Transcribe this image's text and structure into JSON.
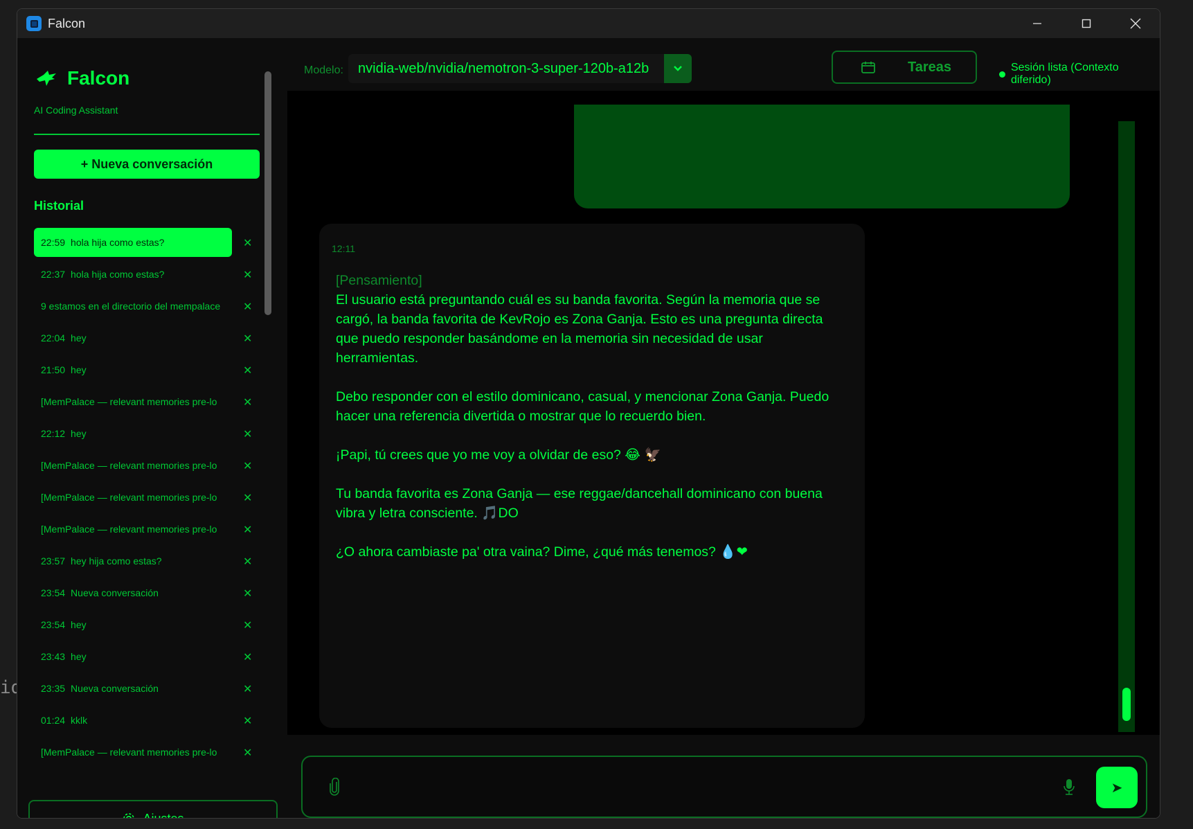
{
  "window": {
    "title": "Falcon"
  },
  "background_text": "id",
  "sidebar": {
    "brand_name": "Falcon",
    "brand_sub": "AI Coding Assistant",
    "new_conversation": "+  Nueva conversación",
    "history_title": "Historial",
    "history": [
      {
        "time": "22:59",
        "label": "hola hija como estas?",
        "active": true
      },
      {
        "time": "22:37",
        "label": "hola hija como estas?"
      },
      {
        "time": "",
        "label": "9  estamos en el directorio del mempalace"
      },
      {
        "time": "22:04",
        "label": "hey"
      },
      {
        "time": "21:50",
        "label": "hey"
      },
      {
        "time": "",
        "label": "[MemPalace — relevant memories pre-lo"
      },
      {
        "time": "22:12",
        "label": "hey"
      },
      {
        "time": "",
        "label": "[MemPalace — relevant memories pre-lo"
      },
      {
        "time": "",
        "label": "[MemPalace — relevant memories pre-lo"
      },
      {
        "time": "",
        "label": "[MemPalace — relevant memories pre-lo"
      },
      {
        "time": "23:57",
        "label": "hey hija como estas?"
      },
      {
        "time": "23:54",
        "label": "Nueva conversación"
      },
      {
        "time": "23:54",
        "label": "hey"
      },
      {
        "time": "23:43",
        "label": "hey"
      },
      {
        "time": "23:35",
        "label": "Nueva conversación"
      },
      {
        "time": "01:24",
        "label": "kklk"
      },
      {
        "time": "",
        "label": "[MemPalace — relevant memories pre-lo"
      }
    ],
    "delete_glyph": "✕",
    "settings_label": "Ajustes"
  },
  "topbar": {
    "model_label": "Modelo:",
    "model_value": "nvidia-web/nvidia/nemotron-3-super-120b-a12b",
    "tasks_label": "Tareas",
    "status": "Sesión lista (Contexto diferido)"
  },
  "message": {
    "time": "12:11",
    "think_tag": "[Pensamiento]",
    "think_text": "El usuario está preguntando cuál es su banda favorita. Según la memoria que se cargó, la banda favorita de KevRojo es Zona Ganja. Esto es una pregunta directa que puedo responder basándome en la memoria sin necesidad de usar herramientas.",
    "p2": "Debo responder con el estilo dominicano, casual, y mencionar Zona Ganja. Puedo hacer una referencia divertida o mostrar que lo recuerdo bien.",
    "p3": "¡Papi, tú crees que yo me voy a olvidar de eso? 😂 🦅",
    "p4": "Tu banda favorita es Zona Ganja — ese reggae/dancehall dominicano con buena vibra y letra consciente. 🎵DO",
    "p5": "¿O ahora cambiaste pa' otra vaina? Dime, ¿qué más tenemos? 💧❤"
  },
  "input": {
    "placeholder": "",
    "send_glyph": "➤"
  },
  "colors": {
    "accent": "#00ff41",
    "dim": "#00c935",
    "bubble_user": "#004d0f",
    "panel": "#0d0d0d"
  }
}
